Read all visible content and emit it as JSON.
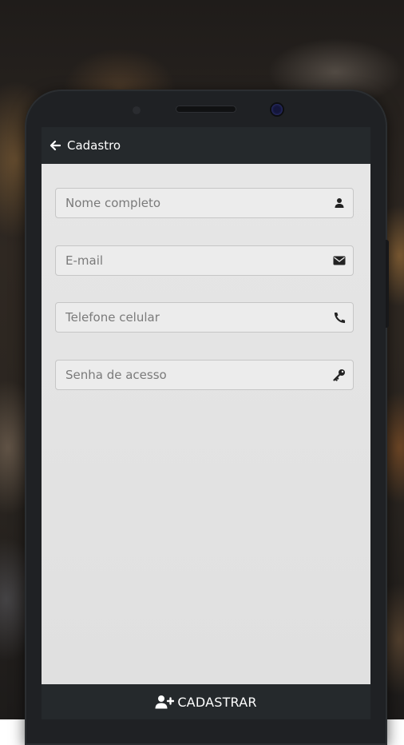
{
  "app_bar": {
    "title": "Cadastro",
    "back_icon": "arrow-left-icon"
  },
  "form": {
    "fields": [
      {
        "placeholder": "Nome completo",
        "value": "",
        "icon": "user-icon"
      },
      {
        "placeholder": "E-mail",
        "value": "",
        "icon": "envelope-icon"
      },
      {
        "placeholder": "Telefone celular",
        "value": "",
        "icon": "phone-icon"
      },
      {
        "placeholder": "Senha de acesso",
        "value": "",
        "icon": "key-icon"
      }
    ]
  },
  "footer": {
    "register_label": "CADASTRAR",
    "register_icon": "user-plus-icon"
  },
  "colors": {
    "bar": "#25292c",
    "screen_bg": "#e2e2e2",
    "field_bg": "#ececec",
    "text_white": "#ffffff",
    "icon_dark": "#222222"
  }
}
